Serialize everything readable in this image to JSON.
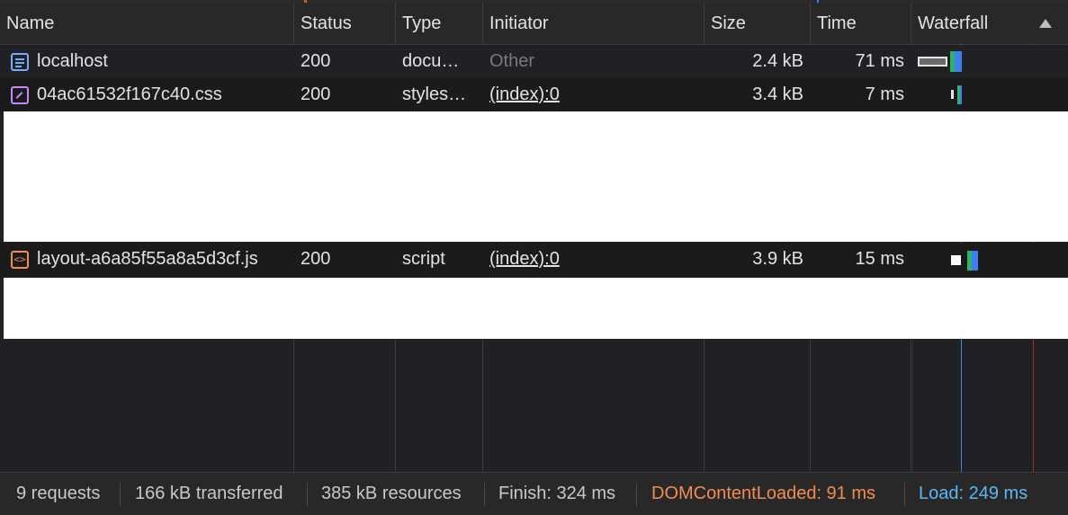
{
  "columns": {
    "name": "Name",
    "status": "Status",
    "type": "Type",
    "initiator": "Initiator",
    "size": "Size",
    "time": "Time",
    "waterfall": "Waterfall"
  },
  "rows": [
    {
      "name": "localhost",
      "icon": "document-icon",
      "status": "200",
      "type": "docu…",
      "initiator": "Other",
      "size": "2.4 kB",
      "time": "71 ms"
    },
    {
      "name": "04ac61532f167c40.css",
      "icon": "stylesheet-icon",
      "status": "200",
      "type": "styles…",
      "initiator": "(index):0",
      "size": "3.4 kB",
      "time": "7 ms"
    },
    {
      "name": "layout-a6a85f55a8a5d3cf.js",
      "icon": "script-icon",
      "status": "200",
      "type": "script",
      "initiator": "(index):0",
      "size": "3.9 kB",
      "time": "15 ms"
    }
  ],
  "footer": {
    "requests": "9 requests",
    "transferred": "166 kB transferred",
    "resources": "385 kB resources",
    "finish": "Finish: 324 ms",
    "dom_content_loaded": "DOMContentLoaded: 91 ms",
    "load": "Load: 249 ms"
  },
  "colors": {
    "dom_content_loaded": "#f28b54",
    "load": "#5cb8f2",
    "waterfall_blue_marker": "#3b82f6",
    "waterfall_red_marker": "#b3261e"
  }
}
